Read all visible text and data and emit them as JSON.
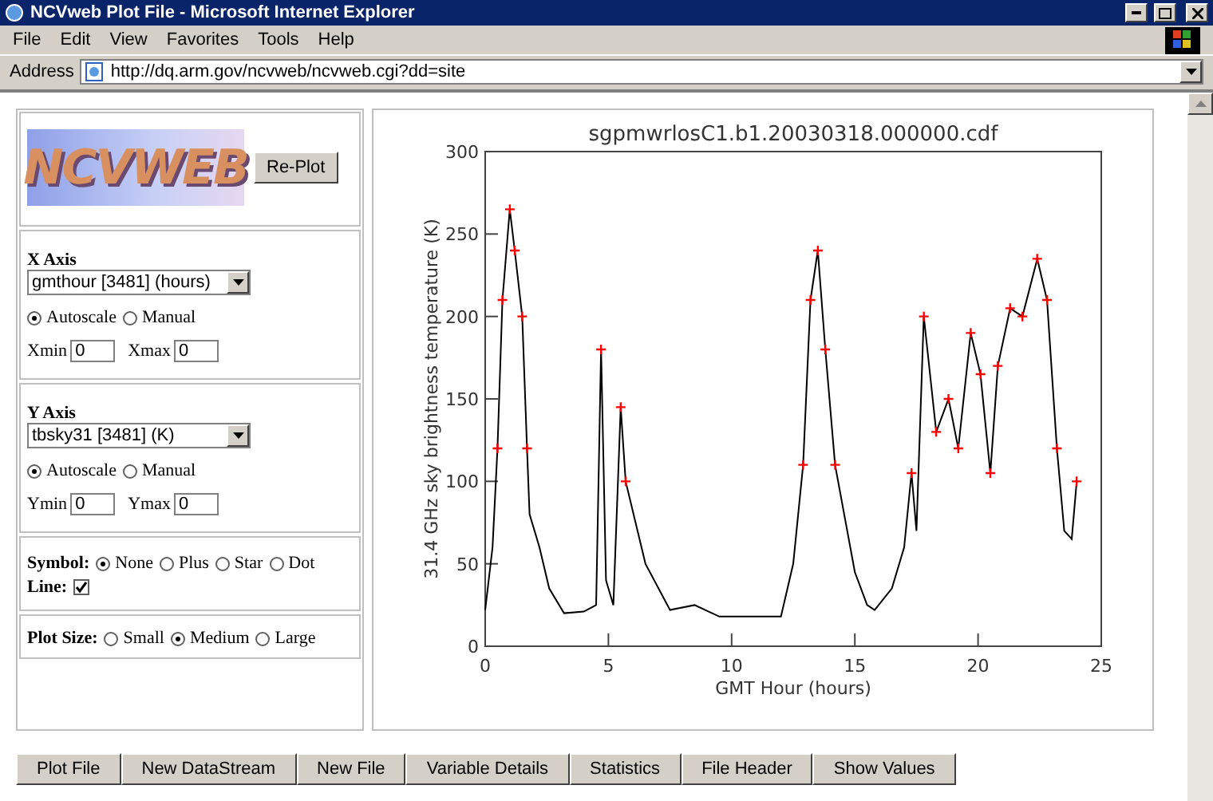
{
  "window": {
    "title": "NCVweb Plot File - Microsoft Internet Explorer"
  },
  "menu": [
    "File",
    "Edit",
    "View",
    "Favorites",
    "Tools",
    "Help"
  ],
  "address": {
    "label": "Address",
    "value": "http://dq.arm.gov/ncvweb/ncvweb.cgi?dd=site"
  },
  "logo": "NCVWEB",
  "replot_button": "Re-Plot",
  "x_axis": {
    "heading": "X Axis",
    "variable": "gmthour [3481] (hours)",
    "scale": [
      {
        "label": "Autoscale",
        "selected": true
      },
      {
        "label": "Manual",
        "selected": false
      }
    ],
    "min_label": "Xmin",
    "min": "0",
    "max_label": "Xmax",
    "max": "0"
  },
  "y_axis": {
    "heading": "Y Axis",
    "variable": "tbsky31 [3481] (K)",
    "scale": [
      {
        "label": "Autoscale",
        "selected": true
      },
      {
        "label": "Manual",
        "selected": false
      }
    ],
    "min_label": "Ymin",
    "min": "0",
    "max_label": "Ymax",
    "max": "0"
  },
  "symbol": {
    "label": "Symbol:",
    "options": [
      {
        "label": "None",
        "selected": true
      },
      {
        "label": "Plus",
        "selected": false
      },
      {
        "label": "Star",
        "selected": false
      },
      {
        "label": "Dot",
        "selected": false
      }
    ]
  },
  "line": {
    "label": "Line:",
    "checked": true
  },
  "plot_size": {
    "label": "Plot Size:",
    "options": [
      {
        "label": "Small",
        "selected": false
      },
      {
        "label": "Medium",
        "selected": true
      },
      {
        "label": "Large",
        "selected": false
      }
    ]
  },
  "plot": {
    "chart_data": {
      "type": "line",
      "title": "sgpmwrlosC1.b1.20030318.000000.cdf",
      "xlabel": "GMT Hour (hours)",
      "ylabel": "31.4 GHz sky brightness temperature (K)",
      "x": [
        0,
        0.3,
        0.5,
        0.7,
        1.0,
        1.2,
        1.5,
        1.7,
        1.8,
        2.2,
        2.6,
        3.2,
        4.0,
        4.5,
        4.7,
        4.9,
        5.2,
        5.5,
        5.7,
        6.5,
        7.5,
        8.5,
        9.5,
        11,
        12,
        12.5,
        12.9,
        13.2,
        13.5,
        13.8,
        14.2,
        15,
        15.5,
        15.8,
        16.5,
        17.0,
        17.3,
        17.5,
        17.8,
        18.3,
        18.8,
        19.2,
        19.7,
        20.1,
        20.5,
        20.8,
        21.3,
        21.8,
        22.4,
        22.8,
        23.2,
        23.5,
        23.8,
        24
      ],
      "series": [
        {
          "color": "#000000",
          "marker": "plus",
          "values": [
            22,
            60,
            120,
            210,
            265,
            240,
            200,
            120,
            80,
            60,
            35,
            20,
            21,
            25,
            180,
            40,
            25,
            145,
            100,
            50,
            22,
            25,
            18,
            18,
            18,
            50,
            110,
            210,
            240,
            180,
            110,
            45,
            25,
            22,
            35,
            60,
            105,
            70,
            200,
            130,
            150,
            120,
            190,
            165,
            105,
            170,
            205,
            200,
            235,
            210,
            120,
            70,
            65,
            100
          ]
        }
      ],
      "xlim": [
        0,
        25
      ],
      "ylim": [
        0,
        300
      ],
      "xticks": [
        0,
        5,
        10,
        15,
        20,
        25
      ],
      "yticks": [
        0,
        50,
        100,
        150,
        200,
        250,
        300
      ]
    }
  },
  "buttons": [
    "Plot File",
    "New DataStream",
    "New File",
    "Variable Details",
    "Statistics",
    "File Header",
    "Show Values"
  ]
}
